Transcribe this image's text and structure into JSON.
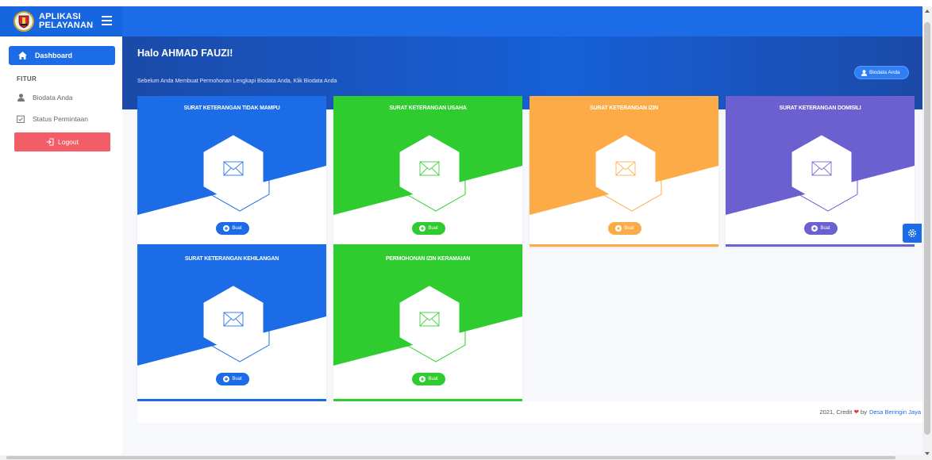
{
  "brand": {
    "line1": "APLIKASI",
    "line2": "PELAYANAN",
    "logo_icon": "regency-emblem-icon",
    "menu_icon": "hamburger-icon"
  },
  "sidebar": {
    "dashboard_label": "Dashboard",
    "section_label": "FITUR",
    "items": [
      {
        "label": "Biodata Anda",
        "icon": "user-icon"
      },
      {
        "label": "Status Permintaan",
        "icon": "checkbox-icon"
      }
    ],
    "logout_label": "Logout"
  },
  "hero": {
    "greeting": "Halo AHMAD FAUZI!",
    "subtitle": "Sebelum Anda Membuat Permohonan Lengkapi Biodata Anda, Klik Biodata Anda",
    "biodata_button": "Biodata Anda"
  },
  "cards": [
    {
      "title": "SURAT KETERANGAN TIDAK MAMPU",
      "button": "Buat",
      "color": "#1b6ce6"
    },
    {
      "title": "SURAT KETERANGAN USAHA",
      "button": "Buat",
      "color": "#2ecc2e"
    },
    {
      "title": "SURAT KETERANGAN IZIN",
      "button": "Buat",
      "color": "#fdab46"
    },
    {
      "title": "SURAT KETERANGAN DOMISILI",
      "button": "Buat",
      "color": "#6c5fcf"
    },
    {
      "title": "SURAT KETERANGAN KEHILANGAN",
      "button": "Buat",
      "color": "#1b6ce6"
    },
    {
      "title": "PERMOHONAN IZIN KERAMAIAN",
      "button": "Buat",
      "color": "#2ecc2e"
    }
  ],
  "footer": {
    "prefix": "2021, Credit",
    "by": "by",
    "link": "Desa Beringin Jaya"
  },
  "colors": {
    "primary": "#1b6ce6",
    "logout": "#f25d68",
    "green": "#2ecc2e",
    "orange": "#fdab46",
    "purple": "#6c5fcf"
  }
}
